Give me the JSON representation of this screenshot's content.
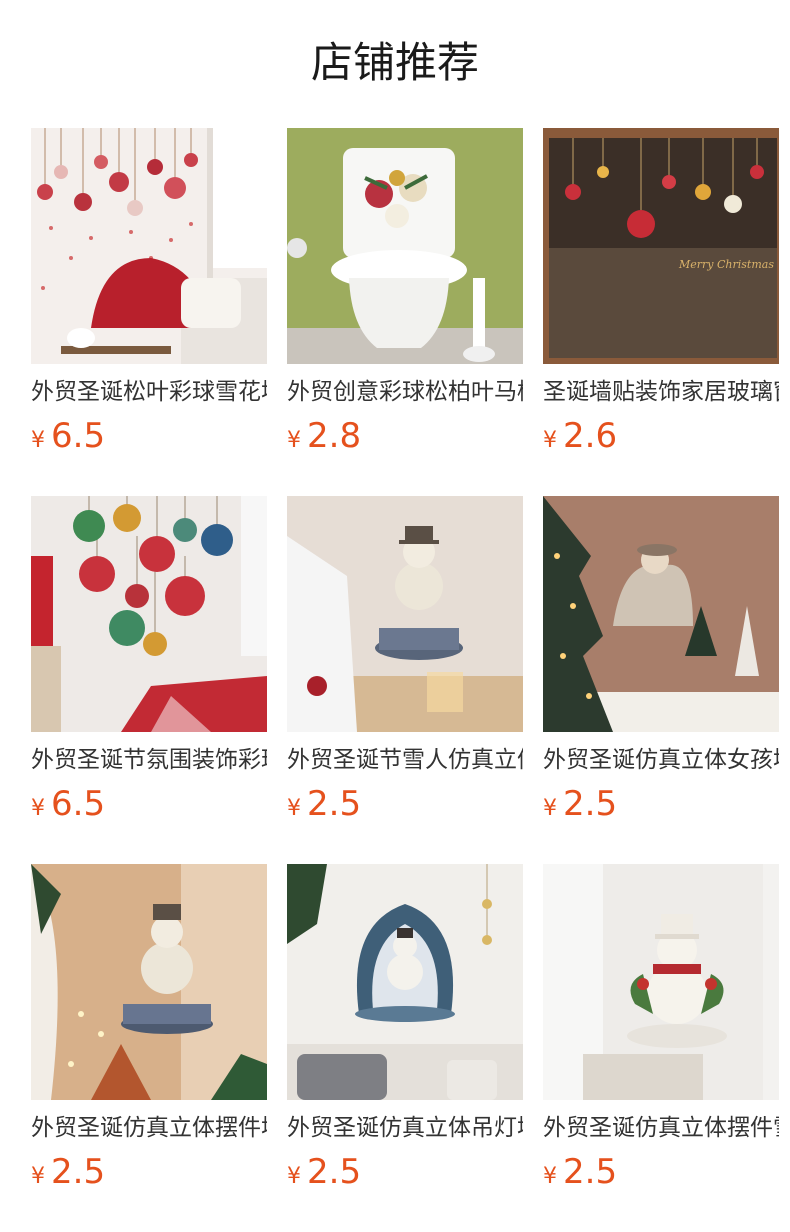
{
  "page": {
    "title": "店铺推荐"
  },
  "theme": {
    "price_color": "#e5511d",
    "title_color": "#1a1a1a",
    "text_color": "#333333"
  },
  "products": [
    {
      "title": "外贸圣诞松叶彩球雪花墙贴",
      "currency": "¥",
      "price": "6.5",
      "thumb_icon": "ornament-window-photo"
    },
    {
      "title": "外贸创意彩球松柏叶马桶贴",
      "currency": "¥",
      "price": "2.8",
      "thumb_icon": "toilet-sticker-photo"
    },
    {
      "title": "圣诞墙贴装饰家居玻璃窗贴",
      "currency": "¥",
      "price": "2.6",
      "thumb_icon": "storefront-window-photo"
    },
    {
      "title": "外贸圣诞节氛围装饰彩球墙贴",
      "currency": "¥",
      "price": "6.5",
      "thumb_icon": "hanging-baubles-photo"
    },
    {
      "title": "外贸圣诞节雪人仿真立体墙贴",
      "currency": "¥",
      "price": "2.5",
      "thumb_icon": "snowman-music-box-photo"
    },
    {
      "title": "外贸圣诞仿真立体女孩墙贴",
      "currency": "¥",
      "price": "2.5",
      "thumb_icon": "girl-house-photo"
    },
    {
      "title": "外贸圣诞仿真立体摆件墙贴",
      "currency": "¥",
      "price": "2.5",
      "thumb_icon": "snowman-room-photo"
    },
    {
      "title": "外贸圣诞仿真立体吊灯墙贴",
      "currency": "¥",
      "price": "2.5",
      "thumb_icon": "snowman-lantern-photo"
    },
    {
      "title": "外贸圣诞仿真立体摆件雪人",
      "currency": "¥",
      "price": "2.5",
      "thumb_icon": "snowman-scarf-photo"
    }
  ]
}
